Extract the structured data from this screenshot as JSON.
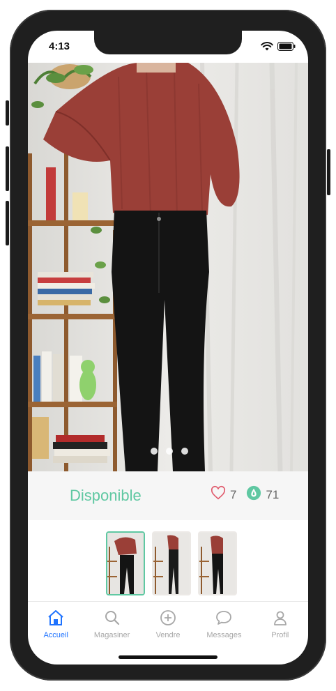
{
  "status": {
    "time": "4:13"
  },
  "product": {
    "availability": "Disponible",
    "likes": "7",
    "views": "71",
    "accent_color": "#5fc8a2",
    "like_color": "#e05a6c"
  },
  "photo": {
    "dots": 3,
    "active_dot": 0
  },
  "thumbnails": [
    {
      "label": "photo-1",
      "active": true
    },
    {
      "label": "photo-2",
      "active": false
    },
    {
      "label": "photo-3",
      "active": false
    }
  ],
  "tabbar": {
    "active_color": "#1f73ff",
    "tabs": [
      {
        "label": "Accueil",
        "icon": "home-icon"
      },
      {
        "label": "Magasiner",
        "icon": "search-icon"
      },
      {
        "label": "Vendre",
        "icon": "plus-circle-icon"
      },
      {
        "label": "Messages",
        "icon": "chat-bubble-icon"
      },
      {
        "label": "Profil",
        "icon": "person-icon"
      }
    ]
  }
}
